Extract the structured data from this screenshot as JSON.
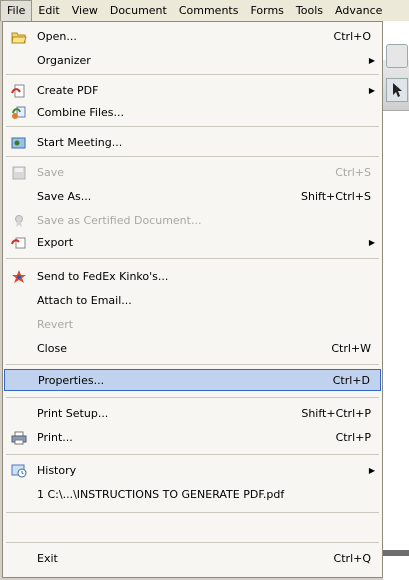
{
  "menubar": [
    "File",
    "Edit",
    "View",
    "Document",
    "Comments",
    "Forms",
    "Tools",
    "Advance"
  ],
  "menu": {
    "open": {
      "label": "Open...",
      "shortcut": "Ctrl+O"
    },
    "organizer": {
      "label": "Organizer"
    },
    "create_pdf": {
      "label": "Create PDF"
    },
    "combine": {
      "label": "Combine Files..."
    },
    "meeting": {
      "label": "Start Meeting..."
    },
    "save": {
      "label": "Save",
      "shortcut": "Ctrl+S"
    },
    "save_as": {
      "label": "Save As...",
      "shortcut": "Shift+Ctrl+S"
    },
    "save_certified": {
      "label": "Save as Certified Document..."
    },
    "export": {
      "label": "Export"
    },
    "fedex": {
      "label": "Send to FedEx Kinko's..."
    },
    "email": {
      "label": "Attach to Email..."
    },
    "revert": {
      "label": "Revert"
    },
    "close": {
      "label": "Close",
      "shortcut": "Ctrl+W"
    },
    "properties": {
      "label": "Properties...",
      "shortcut": "Ctrl+D"
    },
    "print_setup": {
      "label": "Print Setup...",
      "shortcut": "Shift+Ctrl+P"
    },
    "print": {
      "label": "Print...",
      "shortcut": "Ctrl+P"
    },
    "history": {
      "label": "History"
    },
    "recent": {
      "label": "1 C:\\...\\INSTRUCTIONS TO GENERATE PDF.pdf"
    },
    "exit": {
      "label": "Exit",
      "shortcut": "Ctrl+Q"
    }
  },
  "colors": {
    "highlight": "#c1d2ee",
    "highlight_border": "#316ac5",
    "disabled": "#a9a8a2"
  },
  "icons": [
    "folder-open-icon",
    "create-pdf-icon",
    "combine-files-icon",
    "meeting-icon",
    "save-disk-icon",
    "certified-ribbon-icon",
    "export-icon",
    "fedex-star-icon",
    "printer-icon",
    "history-clock-icon"
  ]
}
